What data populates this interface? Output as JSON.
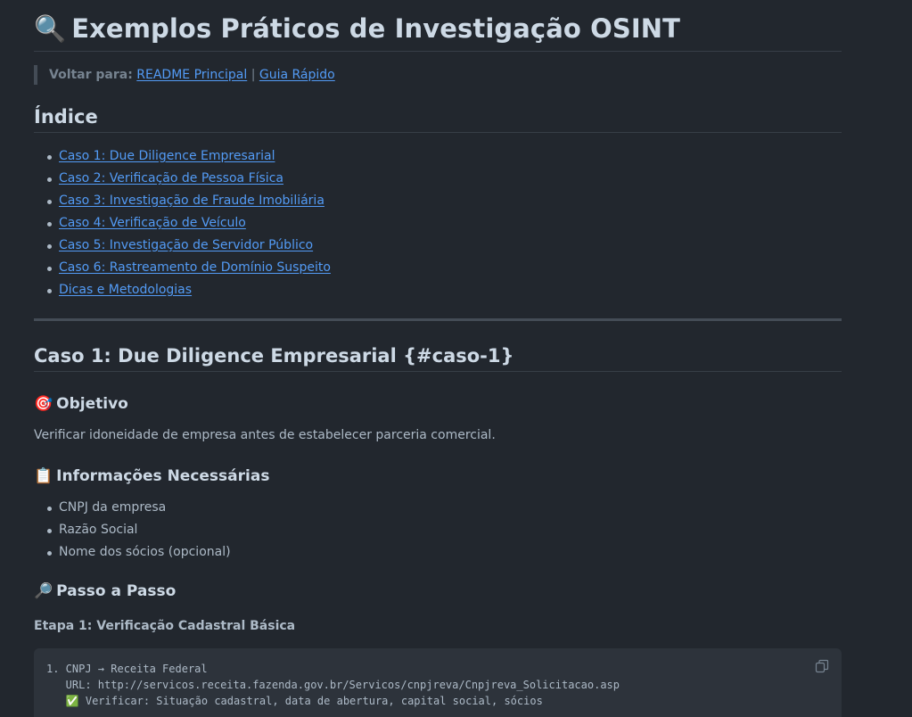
{
  "title": {
    "emoji": "🔍",
    "text": "Exemplos Práticos de Investigação OSINT"
  },
  "back": {
    "label": "Voltar para:",
    "separator": "|",
    "links": [
      {
        "text": "README Principal"
      },
      {
        "text": "Guia Rápido"
      }
    ]
  },
  "index": {
    "heading": "Índice",
    "items": [
      "Caso 1: Due Diligence Empresarial",
      "Caso 2: Verificação de Pessoa Física",
      "Caso 3: Investigação de Fraude Imobiliária",
      "Caso 4: Verificação de Veículo",
      "Caso 5: Investigação de Servidor Público",
      "Caso 6: Rastreamento de Domínio Suspeito",
      "Dicas e Metodologias"
    ]
  },
  "case1": {
    "heading": "Caso 1: Due Diligence Empresarial {#caso-1}",
    "objective": {
      "emoji": "🎯",
      "heading": "Objetivo",
      "text": "Verificar idoneidade de empresa antes de estabelecer parceria comercial."
    },
    "info": {
      "emoji": "📋",
      "heading": "Informações Necessárias",
      "items": [
        "CNPJ da empresa",
        "Razão Social",
        "Nome dos sócios (opcional)"
      ]
    },
    "steps": {
      "emoji": "🔎",
      "heading": "Passo a Passo",
      "stage1": "Etapa 1: Verificação Cadastral Básica",
      "code": [
        "1. CNPJ → Receita Federal",
        "   URL: http://servicos.receita.fazenda.gov.br/Servicos/cnpjreva/Cnpjreva_Solicitacao.asp",
        "   ✅ Verificar: Situação cadastral, data de abertura, capital social, sócios"
      ]
    }
  },
  "icons": {
    "copy": "copy-icon"
  },
  "colors": {
    "background": "#22272e",
    "link": "#539bf5",
    "heading": "#cdd9e5",
    "text": "#adbac7",
    "code_bg": "#2d333b"
  }
}
